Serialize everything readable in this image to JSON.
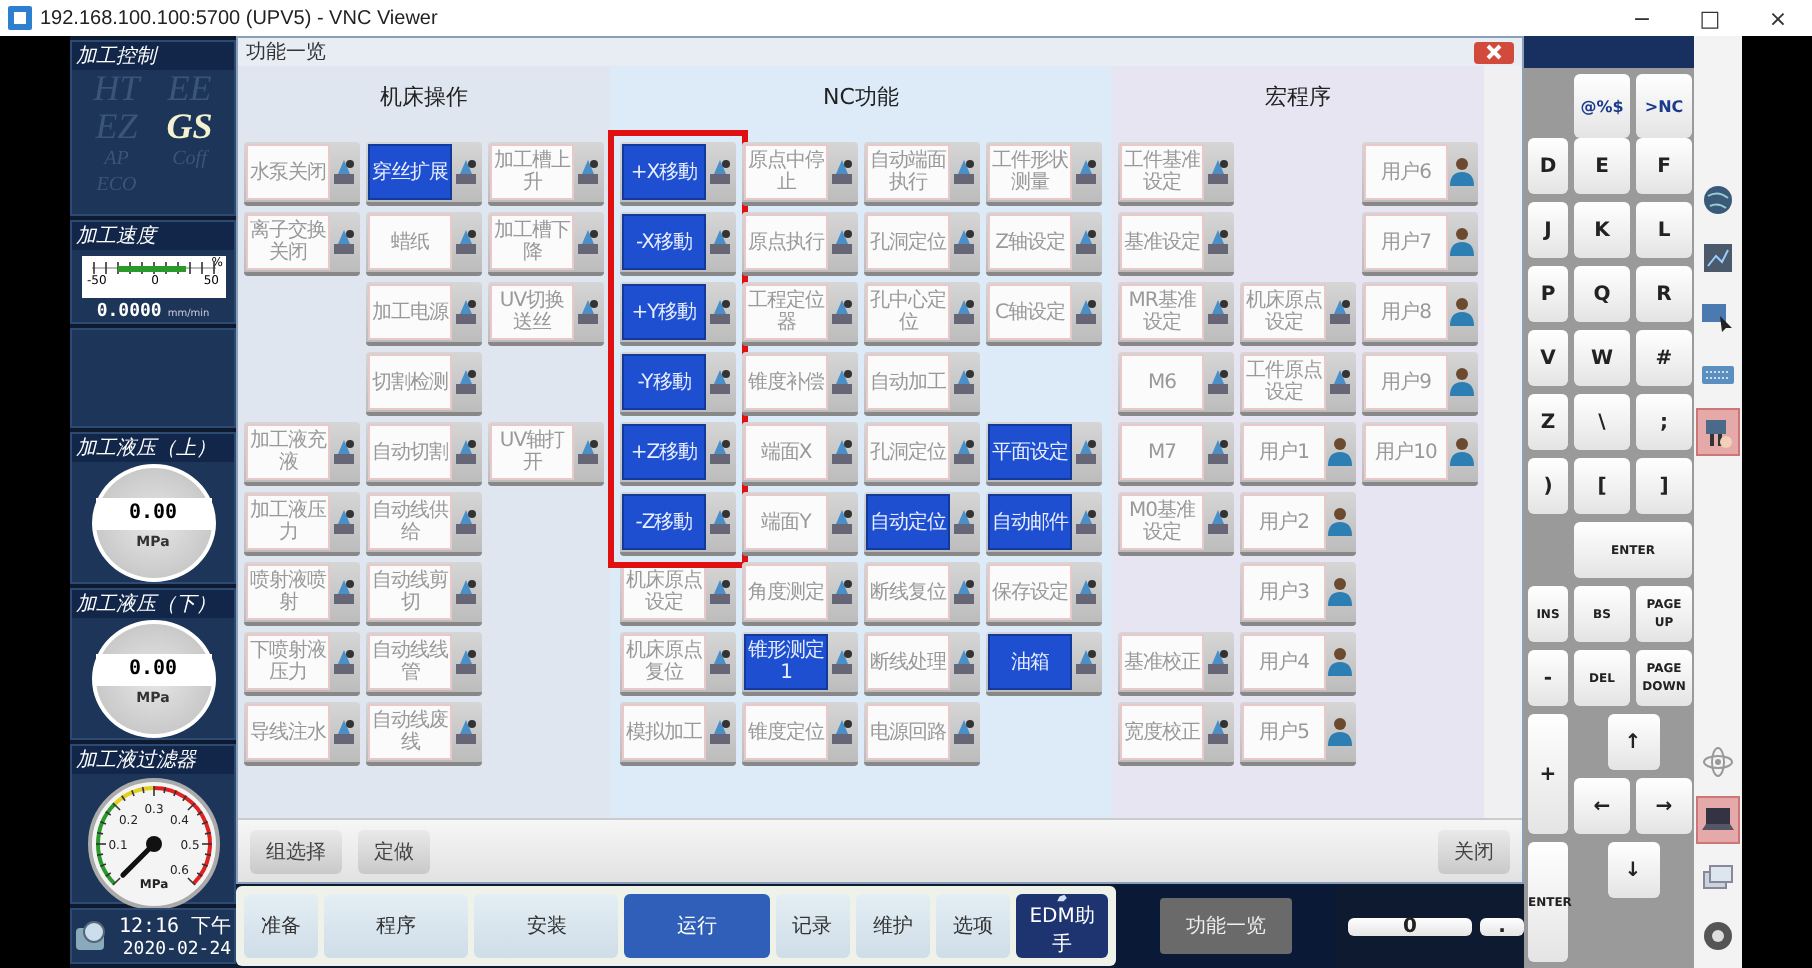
{
  "window": {
    "title": "192.168.100.100:5700 (UPV5) - VNC Viewer",
    "controls": [
      "−",
      "□",
      "×"
    ]
  },
  "left_panel": {
    "control": {
      "title": "加工控制",
      "modes": [
        {
          "label": "HT",
          "selected": false
        },
        {
          "label": "EE",
          "selected": false
        },
        {
          "label": "EZ",
          "selected": false
        },
        {
          "label": "GS",
          "selected": true
        },
        {
          "label": "AP",
          "selected": false
        },
        {
          "label": "Coff",
          "selected": false
        },
        {
          "label": "ECO",
          "selected": false
        }
      ]
    },
    "speed": {
      "title": "加工速度",
      "scale": [
        "-50",
        "0",
        "50"
      ],
      "scale_unit": "%",
      "reading": "0.0000",
      "unit": "mm/min"
    },
    "pressure_upper": {
      "title": "加工液压（上）",
      "reading": "0.00",
      "unit": "MPa"
    },
    "pressure_lower": {
      "title": "加工液压（下）",
      "reading": "0.00",
      "unit": "MPa"
    },
    "filter": {
      "title": "加工液过滤器",
      "ticks": [
        "0.1",
        "0.2",
        "0.3",
        "0.4",
        "0.5",
        "0.6"
      ],
      "unit": "MPa"
    },
    "clock": {
      "time": "12:16 下午",
      "date": "2020-02-24"
    }
  },
  "dialog": {
    "title": "功能一览",
    "sections": [
      {
        "title": "机床操作",
        "columns": [
          [
            {
              "label": "水泵关闭",
              "kind": "tool",
              "on": false,
              "highlighted": false
            },
            {
              "label": "离子交换关闭",
              "kind": "tool",
              "on": false,
              "highlighted": false
            },
            null,
            null,
            {
              "label": "加工液充液",
              "kind": "tool",
              "on": false,
              "highlighted": false
            },
            {
              "label": "加工液压力",
              "kind": "tool",
              "on": false,
              "highlighted": false
            },
            {
              "label": "喷射液喷射",
              "kind": "tool",
              "on": false,
              "highlighted": false
            },
            {
              "label": "下喷射液压力",
              "kind": "tool",
              "on": false,
              "highlighted": false
            },
            {
              "label": "导线注水",
              "kind": "tool",
              "on": false,
              "highlighted": false
            }
          ],
          [
            {
              "label": "穿丝扩展",
              "kind": "tool",
              "on": true,
              "highlighted": false
            },
            {
              "label": "蜡纸",
              "kind": "tool",
              "on": false,
              "highlighted": false
            },
            {
              "label": "加工电源",
              "kind": "tool",
              "on": false,
              "highlighted": false
            },
            {
              "label": "切割检测",
              "kind": "tool",
              "on": false,
              "highlighted": false
            },
            {
              "label": "自动切割",
              "kind": "tool",
              "on": false,
              "highlighted": false
            },
            {
              "label": "自动线供给",
              "kind": "tool",
              "on": false,
              "highlighted": false
            },
            {
              "label": "自动线剪切",
              "kind": "tool",
              "on": false,
              "highlighted": false
            },
            {
              "label": "自动线线管",
              "kind": "tool",
              "on": false,
              "highlighted": false
            },
            {
              "label": "自动线废线",
              "kind": "tool",
              "on": false,
              "highlighted": false
            }
          ],
          [
            {
              "label": "加工槽上升",
              "kind": "tool",
              "on": false,
              "highlighted": false
            },
            {
              "label": "加工槽下降",
              "kind": "tool",
              "on": false,
              "highlighted": false
            },
            {
              "label": "UV切换送丝",
              "kind": "tool",
              "on": false,
              "highlighted": false
            },
            null,
            {
              "label": "UV轴打开",
              "kind": "tool",
              "on": false,
              "highlighted": false
            },
            null,
            null,
            null,
            null
          ]
        ]
      },
      {
        "title": "NC功能",
        "columns": [
          [
            {
              "label": "+X移動",
              "kind": "tool",
              "on": true,
              "highlighted": true
            },
            {
              "label": "-X移動",
              "kind": "tool",
              "on": true,
              "highlighted": true
            },
            {
              "label": "+Y移動",
              "kind": "tool",
              "on": true,
              "highlighted": true
            },
            {
              "label": "-Y移動",
              "kind": "tool",
              "on": true,
              "highlighted": true
            },
            {
              "label": "+Z移動",
              "kind": "tool",
              "on": true,
              "highlighted": true
            },
            {
              "label": "-Z移動",
              "kind": "tool",
              "on": true,
              "highlighted": true
            },
            {
              "label": "机床原点设定",
              "kind": "tool",
              "on": false,
              "highlighted": false
            },
            {
              "label": "机床原点复位",
              "kind": "tool",
              "on": false,
              "highlighted": false
            },
            {
              "label": "模拟加工",
              "kind": "tool",
              "on": false,
              "highlighted": false
            }
          ],
          [
            {
              "label": "原点中停止",
              "kind": "tool",
              "on": false,
              "highlighted": false
            },
            {
              "label": "原点执行",
              "kind": "tool",
              "on": false,
              "highlighted": false
            },
            {
              "label": "工程定位器",
              "kind": "tool",
              "on": false,
              "highlighted": false
            },
            {
              "label": "锥度补偿",
              "kind": "tool",
              "on": false,
              "highlighted": false
            },
            {
              "label": "端面X",
              "kind": "tool",
              "on": false,
              "highlighted": false
            },
            {
              "label": "端面Y",
              "kind": "tool",
              "on": false,
              "highlighted": false
            },
            {
              "label": "角度测定",
              "kind": "tool",
              "on": false,
              "highlighted": false
            },
            {
              "label": "锥形测定1",
              "kind": "tool",
              "on": true,
              "highlighted": false
            },
            {
              "label": "锥度定位",
              "kind": "tool",
              "on": false,
              "highlighted": false
            }
          ],
          [
            {
              "label": "自动端面执行",
              "kind": "tool",
              "on": false,
              "highlighted": false
            },
            {
              "label": "孔洞定位",
              "kind": "tool",
              "on": false,
              "highlighted": false
            },
            {
              "label": "孔中心定位",
              "kind": "tool",
              "on": false,
              "highlighted": false
            },
            {
              "label": "自动加工",
              "kind": "tool",
              "on": false,
              "highlighted": false
            },
            {
              "label": "孔洞定位",
              "kind": "tool",
              "on": false,
              "highlighted": false
            },
            {
              "label": "自动定位",
              "kind": "tool",
              "on": true,
              "highlighted": false
            },
            {
              "label": "断线复位",
              "kind": "tool",
              "on": false,
              "highlighted": false
            },
            {
              "label": "断线处理",
              "kind": "tool",
              "on": false,
              "highlighted": false
            },
            {
              "label": "电源回路",
              "kind": "tool",
              "on": false,
              "highlighted": false
            }
          ],
          [
            {
              "label": "工件形状测量",
              "kind": "tool",
              "on": false,
              "highlighted": false
            },
            {
              "label": "Z轴设定",
              "kind": "tool",
              "on": false,
              "highlighted": false
            },
            {
              "label": "C轴设定",
              "kind": "tool",
              "on": false,
              "highlighted": false
            },
            null,
            {
              "label": "平面设定",
              "kind": "tool",
              "on": true,
              "highlighted": false
            },
            {
              "label": "自动邮件",
              "kind": "tool",
              "on": true,
              "highlighted": false
            },
            {
              "label": "保存设定",
              "kind": "tool",
              "on": false,
              "highlighted": false
            },
            {
              "label": "油箱",
              "kind": "tool",
              "on": true,
              "highlighted": false
            },
            null
          ]
        ]
      },
      {
        "title": "宏程序",
        "columns": [
          [
            {
              "label": "工件基准设定",
              "kind": "tool",
              "on": false,
              "highlighted": false
            },
            {
              "label": "基准设定",
              "kind": "tool",
              "on": false,
              "highlighted": false
            },
            {
              "label": "MR基准设定",
              "kind": "tool",
              "on": false,
              "highlighted": false
            },
            {
              "label": "M6",
              "kind": "tool",
              "on": false,
              "highlighted": false
            },
            {
              "label": "M7",
              "kind": "tool",
              "on": false,
              "highlighted": false
            },
            {
              "label": "M0基准设定",
              "kind": "tool",
              "on": false,
              "highlighted": false
            },
            null,
            {
              "label": "基准校正",
              "kind": "tool",
              "on": false,
              "highlighted": false
            },
            {
              "label": "宽度校正",
              "kind": "tool",
              "on": false,
              "highlighted": false
            }
          ],
          [
            null,
            null,
            {
              "label": "机床原点设定",
              "kind": "tool",
              "on": false,
              "highlighted": false
            },
            {
              "label": "工件原点设定",
              "kind": "tool",
              "on": false,
              "highlighted": false
            },
            {
              "label": "用户1",
              "kind": "user",
              "on": false,
              "highlighted": false
            },
            {
              "label": "用户2",
              "kind": "user",
              "on": false,
              "highlighted": false
            },
            {
              "label": "用户3",
              "kind": "user",
              "on": false,
              "highlighted": false
            },
            {
              "label": "用户4",
              "kind": "user",
              "on": false,
              "highlighted": false
            },
            {
              "label": "用户5",
              "kind": "user",
              "on": false,
              "highlighted": false
            }
          ],
          [
            {
              "label": "用户6",
              "kind": "user",
              "on": false,
              "highlighted": false
            },
            {
              "label": "用户7",
              "kind": "user",
              "on": false,
              "highlighted": false
            },
            {
              "label": "用户8",
              "kind": "user",
              "on": false,
              "highlighted": false
            },
            {
              "label": "用户9",
              "kind": "user",
              "on": false,
              "highlighted": false
            },
            {
              "label": "用户10",
              "kind": "user",
              "on": false,
              "highlighted": false
            },
            null,
            null,
            null,
            null
          ]
        ]
      }
    ],
    "footer_buttons": [
      "组选择",
      "定做"
    ],
    "close_label": "关闭"
  },
  "keyboard": [
    {
      "label": "@%$",
      "kind": "top"
    },
    {
      "label": ">NC",
      "kind": "top"
    },
    {
      "label": "D",
      "kind": "key"
    },
    {
      "label": "E",
      "kind": "key"
    },
    {
      "label": "F",
      "kind": "key"
    },
    {
      "label": "J",
      "kind": "key"
    },
    {
      "label": "K",
      "kind": "key"
    },
    {
      "label": "L",
      "kind": "key"
    },
    {
      "label": "P",
      "kind": "key"
    },
    {
      "label": "Q",
      "kind": "key"
    },
    {
      "label": "R",
      "kind": "key"
    },
    {
      "label": "V",
      "kind": "key"
    },
    {
      "label": "W",
      "kind": "key"
    },
    {
      "label": "#",
      "kind": "key"
    },
    {
      "label": "Z",
      "kind": "key"
    },
    {
      "label": "\\",
      "kind": "key"
    },
    {
      "label": ";",
      "kind": "key"
    },
    {
      "label": ")",
      "kind": "key"
    },
    {
      "label": "[",
      "kind": "key"
    },
    {
      "label": "]",
      "kind": "key"
    },
    {
      "label": "ENTER",
      "kind": "wide"
    },
    {
      "label": "INS",
      "kind": "small"
    },
    {
      "label": "BS",
      "kind": "small"
    },
    {
      "label": "PAGE UP",
      "kind": "small"
    },
    {
      "label": "-",
      "kind": "key"
    },
    {
      "label": "DEL",
      "kind": "small"
    },
    {
      "label": "PAGE DOWN",
      "kind": "small"
    },
    {
      "label": "+",
      "kind": "tall"
    },
    {
      "label": "↑",
      "kind": "mid"
    },
    {
      "label": "←",
      "kind": "key"
    },
    {
      "label": "→",
      "kind": "key"
    },
    {
      "label": "ENTER",
      "kind": "tallsmall"
    },
    {
      "label": "↓",
      "kind": "mid"
    }
  ],
  "bottom_bar": {
    "tabs": [
      {
        "label": "准备",
        "kind": "tab",
        "selected": false
      },
      {
        "label": "程序",
        "kind": "tab",
        "selected": false
      },
      {
        "label": "安装",
        "kind": "tab",
        "selected": false
      },
      {
        "label": "运行",
        "kind": "tab",
        "selected": true
      },
      {
        "label": "记录",
        "kind": "tab",
        "selected": false
      },
      {
        "label": "维护",
        "kind": "tab",
        "selected": false
      },
      {
        "label": "选项",
        "kind": "tab",
        "selected": false
      },
      {
        "label": "EDM助手",
        "kind": "assistant",
        "selected": false
      }
    ],
    "function_list": "功能一览",
    "keys": [
      "0",
      "."
    ]
  },
  "toolbar": [
    {
      "selected": false
    },
    {
      "selected": false
    },
    {
      "selected": false
    },
    {
      "selected": false
    },
    {
      "selected": true
    },
    {
      "selected": false
    },
    {
      "selected": true
    },
    {
      "selected": false
    },
    {
      "selected": false
    }
  ]
}
